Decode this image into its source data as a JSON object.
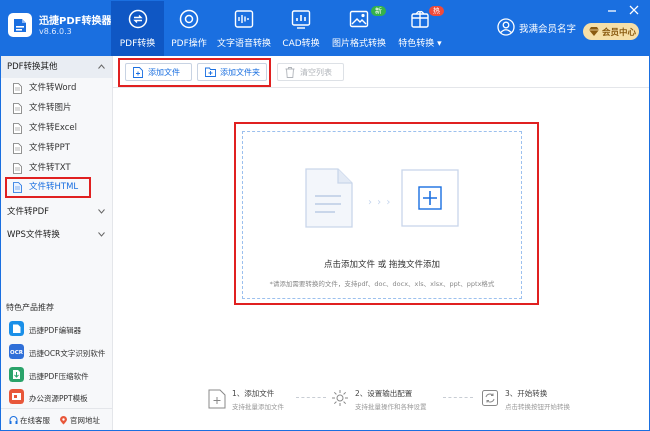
{
  "app": {
    "name": "迅捷PDF转换器",
    "version": "v8.6.0.3"
  },
  "nav": {
    "items": [
      {
        "label": "PDF转换",
        "icon": "pdf-convert-icon",
        "active": true
      },
      {
        "label": "PDF操作",
        "icon": "pdf-operate-icon",
        "active": false
      },
      {
        "label": "文字语音转换",
        "icon": "audio-wave-icon",
        "active": false
      },
      {
        "label": "CAD转换",
        "icon": "cad-chart-icon",
        "active": false
      },
      {
        "label": "图片格式转换",
        "icon": "image-icon",
        "active": false,
        "badge": "新"
      },
      {
        "label": "特色转换",
        "icon": "feature-box-icon",
        "active": false,
        "badge": "热",
        "dropdown": "▾"
      }
    ]
  },
  "user": {
    "name": "我满会员名字",
    "vip_label": "会员中心"
  },
  "window": {
    "minimize": "minimize-icon",
    "close": "close-icon"
  },
  "sidebar": {
    "groups": [
      {
        "label": "PDF转换其他",
        "expanded": true,
        "items": [
          "文件转Word",
          "文件转图片",
          "文件转Excel",
          "文件转PPT",
          "文件转TXT",
          "文件转HTML"
        ]
      },
      {
        "label": "文件转PDF",
        "expanded": false
      },
      {
        "label": "WPS文件转换",
        "expanded": false
      }
    ],
    "selected_item": "文件转HTML",
    "products_title": "特色产品推荐",
    "products": [
      {
        "label": "迅捷PDF编辑器",
        "color": "#1a8fe8"
      },
      {
        "label": "迅捷OCR文字识别软件",
        "color": "#2f6fd8"
      },
      {
        "label": "迅捷PDF压缩软件",
        "color": "#2aa36a"
      },
      {
        "label": "办公资源PPT模板",
        "color": "#e8573a"
      }
    ],
    "footer": {
      "online_service": "在线客服",
      "official_site": "官网地址"
    }
  },
  "toolbar": {
    "add_file": "添加文件",
    "add_folder": "添加文件夹",
    "clear_list": "清空列表"
  },
  "dropzone": {
    "title": "点击添加文件 或 拖拽文件添加",
    "hint": "*请添加需要转换的文件，支持pdf、doc、docx、xls、xlsx、ppt、pptx格式",
    "arrows": "› › ›"
  },
  "steps": [
    {
      "title": "1、添加文件",
      "desc": "支持批量添加文件",
      "icon": "add-file-icon"
    },
    {
      "title": "2、设置输出配置",
      "desc": "支持批量操作和各种设置",
      "icon": "settings-gear-icon"
    },
    {
      "title": "3、开始转换",
      "desc": "点击转换按钮开始转换",
      "icon": "convert-cycle-icon"
    }
  ],
  "colors": {
    "brand": "#1a6fe0",
    "highlight_box": "#e02020"
  }
}
